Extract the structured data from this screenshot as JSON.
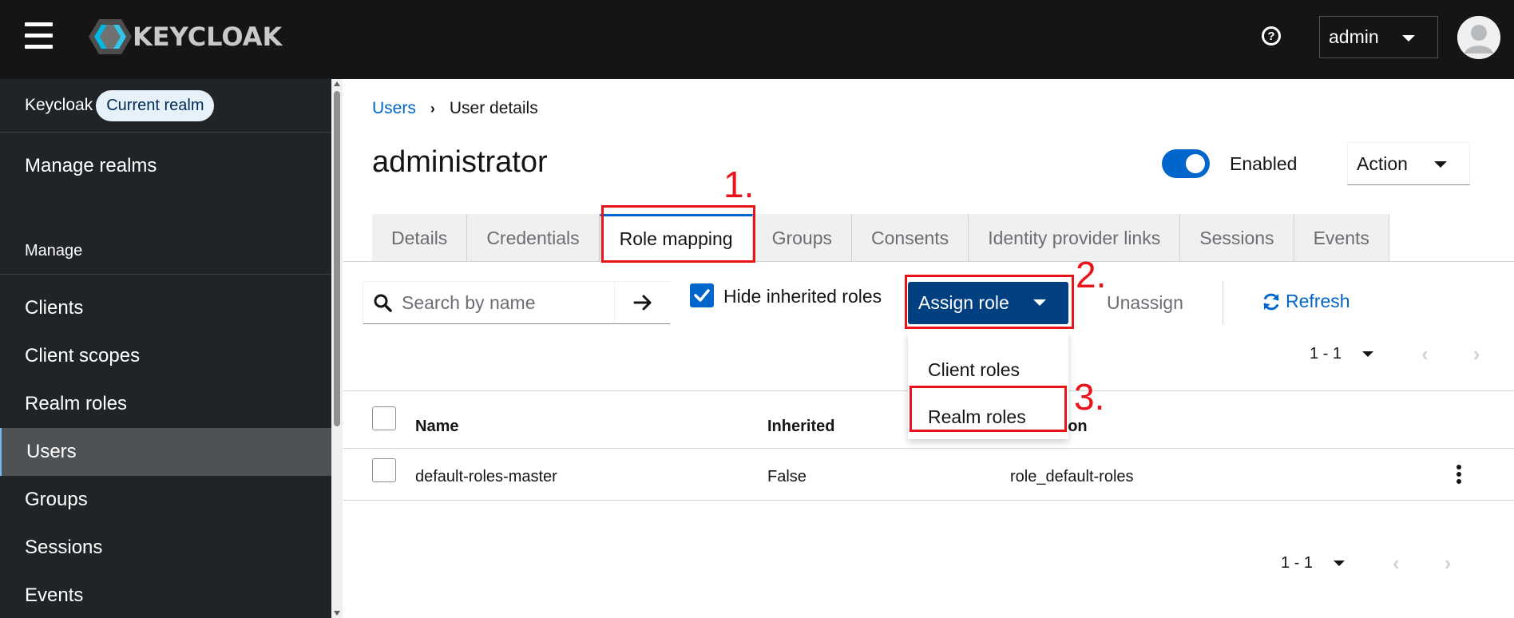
{
  "header": {
    "brand": "KEYCLOAK",
    "user_menu_label": "admin",
    "icons": [
      "hamburger-icon",
      "keycloak-logo",
      "help-icon",
      "avatar"
    ]
  },
  "sidebar": {
    "realm_name": "Keycloak",
    "realm_badge": "Current realm",
    "manage_realms": "Manage realms",
    "section_title": "Manage",
    "items": [
      {
        "label": "Clients"
      },
      {
        "label": "Client scopes"
      },
      {
        "label": "Realm roles"
      },
      {
        "label": "Users"
      },
      {
        "label": "Groups"
      },
      {
        "label": "Sessions"
      },
      {
        "label": "Events"
      }
    ],
    "active_item": "Users"
  },
  "breadcrumb": {
    "root": "Users",
    "current": "User details"
  },
  "page": {
    "title": "administrator",
    "enabled_label": "Enabled",
    "enabled": true,
    "action_label": "Action"
  },
  "tabs": [
    {
      "label": "Details"
    },
    {
      "label": "Credentials"
    },
    {
      "label": "Role mapping"
    },
    {
      "label": "Groups"
    },
    {
      "label": "Consents"
    },
    {
      "label": "Identity provider links"
    },
    {
      "label": "Sessions"
    },
    {
      "label": "Events"
    }
  ],
  "active_tab": "Role mapping",
  "toolbar": {
    "search_placeholder": "Search by name",
    "hide_inherited_label": "Hide inherited roles",
    "hide_inherited_checked": true,
    "assign_role_label": "Assign role",
    "unassign_label": "Unassign",
    "refresh_label": "Refresh"
  },
  "pagination": {
    "top_range": "1 - 1",
    "bottom_range": "1 - 1"
  },
  "assign_menu": {
    "items": [
      {
        "label": "Client roles"
      },
      {
        "label": "Realm roles"
      }
    ]
  },
  "table": {
    "columns": [
      "Name",
      "Inherited",
      "tion"
    ],
    "rows": [
      {
        "name": "default-roles-master",
        "inherited": "False",
        "description": "role_default-roles"
      }
    ]
  },
  "annotations": {
    "step1": "1.",
    "step2": "2.",
    "step3": "3.",
    "color": "#e8141a"
  },
  "colors": {
    "masthead": "#151515",
    "sidebar": "#212427",
    "primary": "#0066cc",
    "assign_button": "#004080"
  }
}
